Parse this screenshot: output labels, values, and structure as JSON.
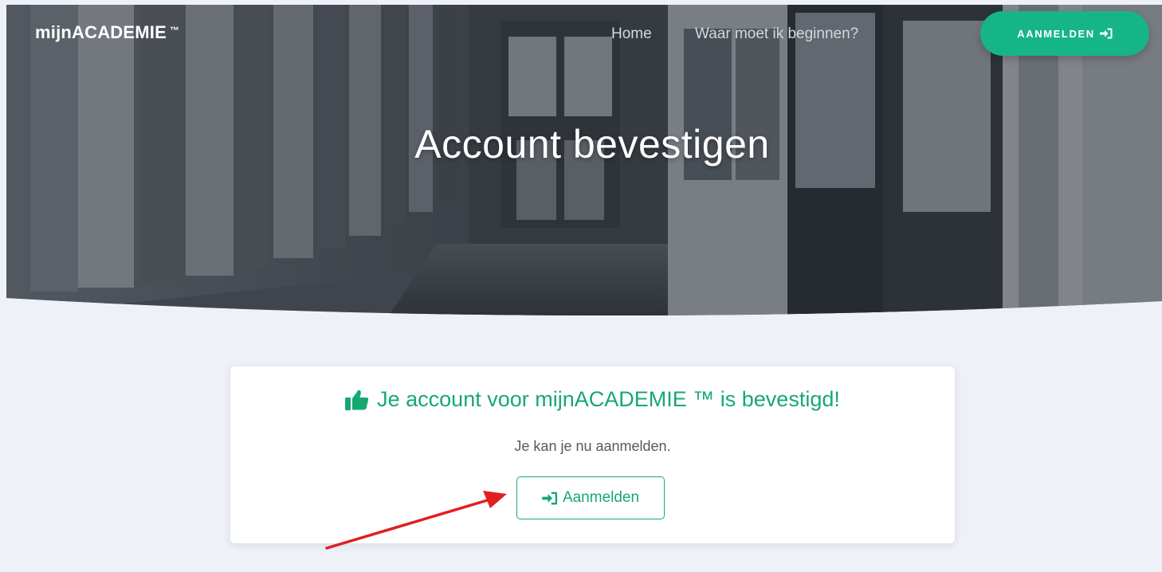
{
  "navbar": {
    "brand": "mijnACADEMIE",
    "brand_tm": "™",
    "links": [
      "Home",
      "Waar moet ik beginnen?"
    ],
    "login_button": "AANMELDEN",
    "login_icon": "sign-in-icon"
  },
  "hero": {
    "title": "Account bevestigen"
  },
  "card": {
    "title": "Je account voor mijnACADEMIE ™ is bevestigd!",
    "title_icon": "thumbs-up-icon",
    "text": "Je kan je nu aanmelden.",
    "button": "Aanmelden",
    "button_icon": "sign-in-icon"
  },
  "colors": {
    "accent": "#16b588",
    "accent_text": "#17a872",
    "background": "#eef1f7",
    "annotation_arrow": "#e02020"
  }
}
